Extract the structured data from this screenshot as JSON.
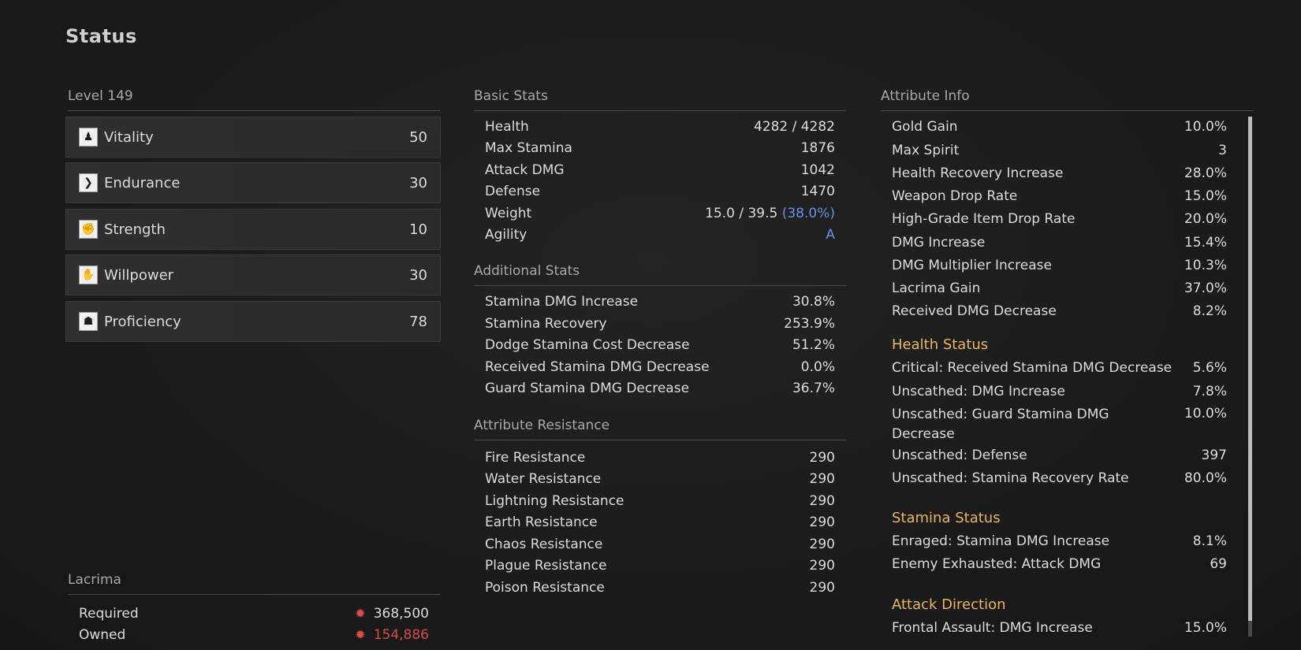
{
  "title": "Status",
  "level_label": "Level 149",
  "attributes": [
    {
      "label": "Vitality",
      "value": "50",
      "icon": "vitality-icon",
      "glyph": "♟"
    },
    {
      "label": "Endurance",
      "value": "30",
      "icon": "endurance-icon",
      "glyph": "❯"
    },
    {
      "label": "Strength",
      "value": "10",
      "icon": "strength-icon",
      "glyph": "✊"
    },
    {
      "label": "Willpower",
      "value": "30",
      "icon": "willpower-icon",
      "glyph": "✋"
    },
    {
      "label": "Proficiency",
      "value": "78",
      "icon": "proficiency-icon",
      "glyph": "☗"
    }
  ],
  "lacrima": {
    "header": "Lacrima",
    "required_label": "Required",
    "required_value": "368,500",
    "owned_label": "Owned",
    "owned_value": "154,886"
  },
  "basic_stats": {
    "header": "Basic Stats",
    "rows": [
      {
        "label": "Health",
        "value": "4282 / 4282"
      },
      {
        "label": "Max Stamina",
        "value": "1876"
      },
      {
        "label": "Attack DMG",
        "value": "1042"
      },
      {
        "label": "Defense",
        "value": "1470"
      },
      {
        "label": "Weight",
        "value": "15.0 / 39.5",
        "extra": "(38.0%)"
      },
      {
        "label": "Agility",
        "value": "",
        "extra": "A"
      }
    ]
  },
  "additional_stats": {
    "header": "Additional Stats",
    "rows": [
      {
        "label": "Stamina DMG Increase",
        "value": "30.8%"
      },
      {
        "label": "Stamina Recovery",
        "value": "253.9%"
      },
      {
        "label": "Dodge Stamina Cost Decrease",
        "value": "51.2%"
      },
      {
        "label": "Received Stamina DMG Decrease",
        "value": "0.0%"
      },
      {
        "label": "Guard Stamina DMG Decrease",
        "value": "36.7%"
      }
    ]
  },
  "attribute_resistance": {
    "header": "Attribute Resistance",
    "rows": [
      {
        "label": "Fire Resistance",
        "value": "290"
      },
      {
        "label": "Water Resistance",
        "value": "290"
      },
      {
        "label": "Lightning Resistance",
        "value": "290"
      },
      {
        "label": "Earth Resistance",
        "value": "290"
      },
      {
        "label": "Chaos Resistance",
        "value": "290"
      },
      {
        "label": "Plague Resistance",
        "value": "290"
      },
      {
        "label": "Poison Resistance",
        "value": "290"
      }
    ]
  },
  "attribute_info": {
    "header": "Attribute Info",
    "rows": [
      {
        "label": "Gold Gain",
        "value": "10.0%"
      },
      {
        "label": "Max Spirit",
        "value": "3"
      },
      {
        "label": "Health Recovery Increase",
        "value": "28.0%"
      },
      {
        "label": "Weapon Drop Rate",
        "value": "15.0%"
      },
      {
        "label": "High-Grade Item Drop Rate",
        "value": "20.0%"
      },
      {
        "label": "DMG Increase",
        "value": "15.4%"
      },
      {
        "label": "DMG Multiplier Increase",
        "value": "10.3%"
      },
      {
        "label": "Lacrima Gain",
        "value": "37.0%"
      },
      {
        "label": "Received DMG Decrease",
        "value": "8.2%"
      }
    ]
  },
  "health_status": {
    "header": "Health Status",
    "rows": [
      {
        "label": "Critical: Received Stamina DMG Decrease",
        "value": "5.6%"
      },
      {
        "label": "Unscathed: DMG Increase",
        "value": "7.8%"
      },
      {
        "label": "Unscathed: Guard Stamina DMG Decrease",
        "value": "10.0%"
      },
      {
        "label": "Unscathed: Defense",
        "value": "397"
      },
      {
        "label": "Unscathed: Stamina Recovery Rate",
        "value": "80.0%"
      }
    ]
  },
  "stamina_status": {
    "header": "Stamina Status",
    "rows": [
      {
        "label": "Enraged: Stamina DMG Increase",
        "value": "8.1%"
      },
      {
        "label": "Enemy Exhausted: Attack DMG",
        "value": "69"
      }
    ]
  },
  "attack_direction": {
    "header": "Attack Direction",
    "rows": [
      {
        "label": "Frontal Assault: DMG Increase",
        "value": "15.0%"
      }
    ]
  },
  "colors": {
    "accent_gold": "#e8b85a",
    "highlight_blue": "#6f8fe0",
    "lacrima_red": "#d94a4a"
  }
}
